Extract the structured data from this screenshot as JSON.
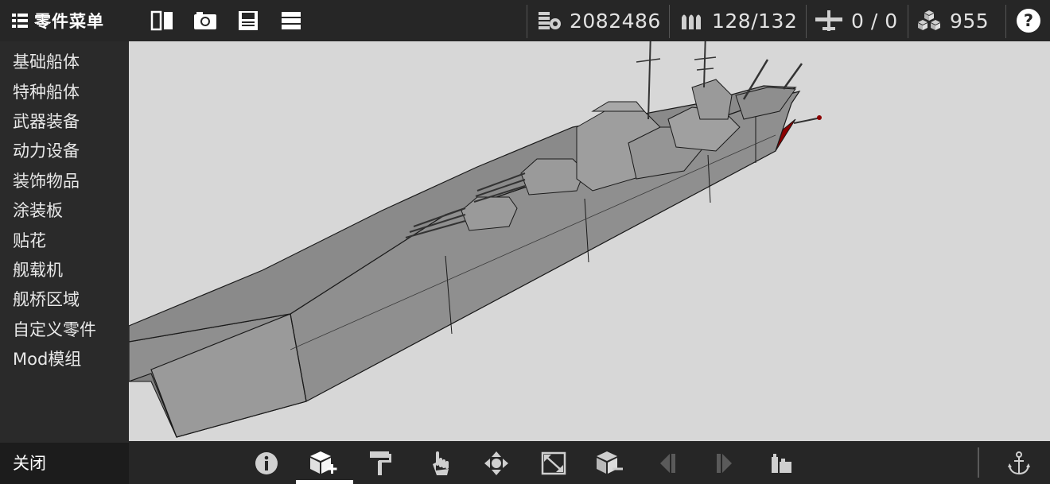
{
  "header": {
    "menu_title": "零件菜单",
    "stats": {
      "cost": "2082486",
      "ammo": "128/132",
      "aircraft": "0 / 0",
      "parts": "955"
    },
    "help_symbol": "?"
  },
  "sidebar": {
    "items": [
      {
        "label": "基础船体"
      },
      {
        "label": "特种船体"
      },
      {
        "label": "武器装备"
      },
      {
        "label": "动力设备"
      },
      {
        "label": "装饰物品"
      },
      {
        "label": "涂装板"
      },
      {
        "label": "贴花"
      },
      {
        "label": "舰载机"
      },
      {
        "label": "舰桥区域"
      },
      {
        "label": "自定义零件"
      },
      {
        "label": "Mod模组"
      }
    ],
    "close_label": "关闭"
  },
  "toolbar_top_icons": [
    "mirror-icon",
    "screenshot-icon",
    "save-icon",
    "list-icon"
  ],
  "toolbar_bottom_icons": [
    "info-icon",
    "add-part-icon",
    "paint-roller-icon",
    "hand-select-icon",
    "move-icon",
    "scale-icon",
    "remove-part-icon",
    "undo-icon",
    "redo-icon",
    "group-icon",
    "anchor-icon"
  ],
  "colors": {
    "background": "#262626",
    "viewport": "#d7d7d7",
    "hull_gray": "#8f8f8f",
    "hull_red": "#8b0000",
    "accent_white": "#ffffff"
  }
}
